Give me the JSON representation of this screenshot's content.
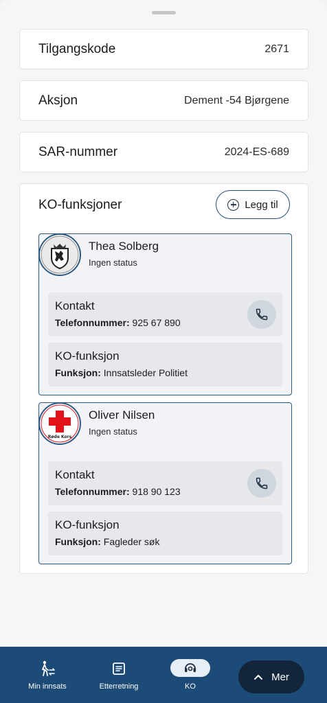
{
  "info_rows": [
    {
      "label": "Tilgangskode",
      "value": "2671"
    },
    {
      "label": "Aksjon",
      "value": "Dement -54 Bjørgene"
    },
    {
      "label": "SAR-nummer",
      "value": "2024-ES-689"
    }
  ],
  "ko": {
    "header": "KO-funksjoner",
    "add_label": "Legg til",
    "persons": [
      {
        "name": "Thea Solberg",
        "status": "Ingen status",
        "org_icon": "politi-logo",
        "contact_title": "Kontakt",
        "phone_label": "Telefonnummer:",
        "phone": "925 67 890",
        "function_title": "KO-funksjon",
        "function_label": "Funksjon:",
        "function": "Innsatsleder Politiet"
      },
      {
        "name": "Oliver Nilsen",
        "status": "Ingen status",
        "org_icon": "rode-kors-logo",
        "org_text": "Røde Kors",
        "contact_title": "Kontakt",
        "phone_label": "Telefonnummer:",
        "phone": "918 90 123",
        "function_title": "KO-funksjon",
        "function_label": "Funksjon:",
        "function": "Fagleder søk"
      }
    ]
  },
  "nav": {
    "items": [
      {
        "label": "Min innsats",
        "icon": "person-walking-icon"
      },
      {
        "label": "Etterretning",
        "icon": "document-icon"
      },
      {
        "label": "KO",
        "icon": "headset-icon",
        "active": true
      }
    ],
    "more_label": "Mer"
  },
  "colors": {
    "nav_bg": "#1d4b77",
    "accent_border": "#2c5882",
    "more_bg": "#13253a"
  }
}
